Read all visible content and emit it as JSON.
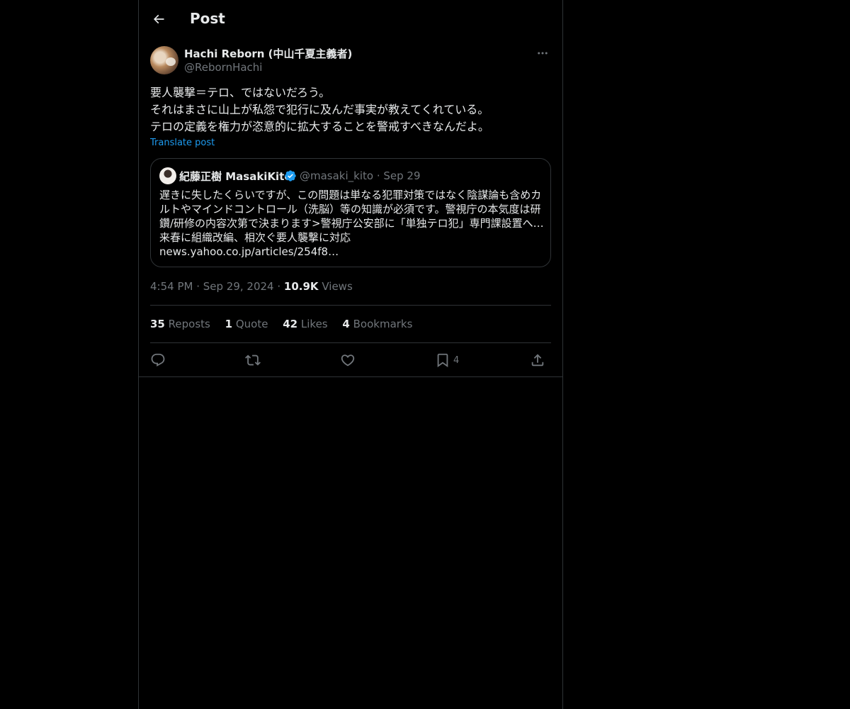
{
  "header": {
    "title": "Post"
  },
  "post": {
    "author_name": "Hachi Reborn (中山千夏主義者)",
    "author_handle": "@RebornHachi",
    "text_lines": [
      "要人襲撃＝テロ、ではないだろう。",
      "それはまさに山上が私怨で犯行に及んだ事実が教えてくれている。",
      "テロの定義を権力が恣意的に拡大することを警戒すべきなんだよ。"
    ],
    "translate_label": "Translate post",
    "time": "4:54 PM",
    "date": "Sep 29, 2024",
    "views_count": "10.9K",
    "views_label": "Views"
  },
  "quote": {
    "author_name": "紀藤正樹 MasakiKito",
    "author_handle": "@masaki_kito",
    "date": "Sep 29",
    "text_lines": [
      "遅きに失したくらいですが、この問題は単なる犯罪対策ではなく陰謀論も含めカ",
      "ルトやマインドコントロール（洗脳）等の知識が必須です。警視庁の本気度は研",
      "鑽/研修の内容次第で決まります>警視庁公安部に「単独テロ犯」専門課設置へ…",
      "来春に組織改編、相次ぐ要人襲撃に対応",
      "news.yahoo.co.jp/articles/254f8…"
    ]
  },
  "stats": {
    "reposts_count": "35",
    "reposts_label": "Reposts",
    "quotes_count": "1",
    "quotes_label": "Quote",
    "likes_count": "42",
    "likes_label": "Likes",
    "bookmarks_count": "4",
    "bookmarks_label": "Bookmarks"
  },
  "actions": {
    "bookmark_count": "4"
  },
  "icons": [
    "back-arrow-icon",
    "more-icon",
    "verified-badge-icon",
    "reply-icon",
    "repost-icon",
    "like-icon",
    "bookmark-icon",
    "share-icon"
  ],
  "colors": {
    "background": "#000000",
    "text": "#e7e9ea",
    "muted": "#71767b",
    "link": "#1d9bf0",
    "border": "#2f3336"
  }
}
